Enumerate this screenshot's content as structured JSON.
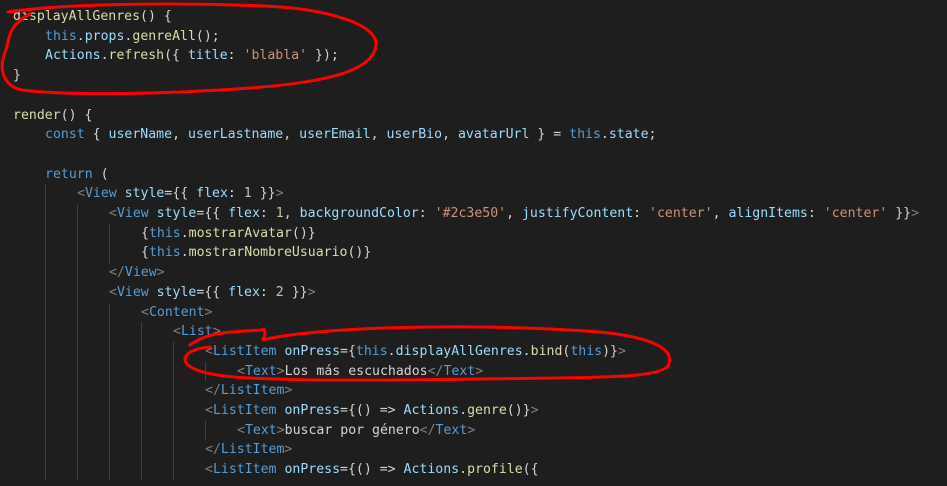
{
  "editor": {
    "colors": {
      "background": "#1e1e1e",
      "keyword": "#569cd6",
      "function": "#dcdcaa",
      "variable": "#9cdcfe",
      "string": "#ce9178",
      "number": "#b5cea8",
      "text": "#d4d4d4",
      "annotation": "#ff0000"
    },
    "lines": [
      {
        "indent": 0,
        "tokens": [
          [
            "fn",
            "displayAllGenres"
          ],
          [
            "plain",
            "() {"
          ]
        ]
      },
      {
        "indent": 1,
        "tokens": [
          [
            "kw",
            "this"
          ],
          [
            "plain",
            "."
          ],
          [
            "var",
            "props"
          ],
          [
            "plain",
            "."
          ],
          [
            "fn",
            "genreAll"
          ],
          [
            "plain",
            "();"
          ]
        ]
      },
      {
        "indent": 1,
        "tokens": [
          [
            "var",
            "Actions"
          ],
          [
            "plain",
            "."
          ],
          [
            "fn",
            "refresh"
          ],
          [
            "plain",
            "({ "
          ],
          [
            "var",
            "title"
          ],
          [
            "plain",
            ": "
          ],
          [
            "str",
            "'blabla'"
          ],
          [
            "plain",
            " });"
          ]
        ]
      },
      {
        "indent": 0,
        "tokens": [
          [
            "plain",
            "}"
          ]
        ]
      },
      {
        "indent": 0,
        "tokens": []
      },
      {
        "indent": 0,
        "tokens": [
          [
            "fn",
            "render"
          ],
          [
            "plain",
            "() {"
          ]
        ]
      },
      {
        "indent": 1,
        "tokens": [
          [
            "kw",
            "const"
          ],
          [
            "plain",
            " { "
          ],
          [
            "var",
            "userName"
          ],
          [
            "plain",
            ", "
          ],
          [
            "var",
            "userLastname"
          ],
          [
            "plain",
            ", "
          ],
          [
            "var",
            "userEmail"
          ],
          [
            "plain",
            ", "
          ],
          [
            "var",
            "userBio"
          ],
          [
            "plain",
            ", "
          ],
          [
            "var",
            "avatarUrl"
          ],
          [
            "plain",
            " } = "
          ],
          [
            "kw",
            "this"
          ],
          [
            "plain",
            "."
          ],
          [
            "var",
            "state"
          ],
          [
            "plain",
            ";"
          ]
        ]
      },
      {
        "indent": 0,
        "tokens": []
      },
      {
        "indent": 1,
        "tokens": [
          [
            "kw",
            "return"
          ],
          [
            "plain",
            " ("
          ]
        ]
      },
      {
        "indent": 2,
        "tokens": [
          [
            "punc",
            "<"
          ],
          [
            "tag",
            "View"
          ],
          [
            "plain",
            " "
          ],
          [
            "attr",
            "style"
          ],
          [
            "plain",
            "={{ "
          ],
          [
            "var",
            "flex"
          ],
          [
            "plain",
            ": "
          ],
          [
            "num",
            "1"
          ],
          [
            "plain",
            " }}"
          ],
          [
            "punc",
            ">"
          ]
        ]
      },
      {
        "indent": 3,
        "tokens": [
          [
            "punc",
            "<"
          ],
          [
            "tag",
            "View"
          ],
          [
            "plain",
            " "
          ],
          [
            "attr",
            "style"
          ],
          [
            "plain",
            "={{ "
          ],
          [
            "var",
            "flex"
          ],
          [
            "plain",
            ": "
          ],
          [
            "num",
            "1"
          ],
          [
            "plain",
            ", "
          ],
          [
            "var",
            "backgroundColor"
          ],
          [
            "plain",
            ": "
          ],
          [
            "str",
            "'#2c3e50'"
          ],
          [
            "plain",
            ", "
          ],
          [
            "var",
            "justifyContent"
          ],
          [
            "plain",
            ": "
          ],
          [
            "str",
            "'center'"
          ],
          [
            "plain",
            ", "
          ],
          [
            "var",
            "alignItems"
          ],
          [
            "plain",
            ": "
          ],
          [
            "str",
            "'center'"
          ],
          [
            "plain",
            " }}"
          ],
          [
            "punc",
            ">"
          ]
        ]
      },
      {
        "indent": 4,
        "tokens": [
          [
            "plain",
            "{"
          ],
          [
            "kw",
            "this"
          ],
          [
            "plain",
            "."
          ],
          [
            "fn",
            "mostrarAvatar"
          ],
          [
            "plain",
            "()}"
          ]
        ]
      },
      {
        "indent": 4,
        "tokens": [
          [
            "plain",
            "{"
          ],
          [
            "kw",
            "this"
          ],
          [
            "plain",
            "."
          ],
          [
            "fn",
            "mostrarNombreUsuario"
          ],
          [
            "plain",
            "()}"
          ]
        ]
      },
      {
        "indent": 3,
        "tokens": [
          [
            "punc",
            "</"
          ],
          [
            "tag",
            "View"
          ],
          [
            "punc",
            ">"
          ]
        ]
      },
      {
        "indent": 3,
        "tokens": [
          [
            "punc",
            "<"
          ],
          [
            "tag",
            "View"
          ],
          [
            "plain",
            " "
          ],
          [
            "attr",
            "style"
          ],
          [
            "plain",
            "={{ "
          ],
          [
            "var",
            "flex"
          ],
          [
            "plain",
            ": "
          ],
          [
            "num",
            "2"
          ],
          [
            "plain",
            " }}"
          ],
          [
            "punc",
            ">"
          ]
        ]
      },
      {
        "indent": 4,
        "tokens": [
          [
            "punc",
            "<"
          ],
          [
            "tag",
            "Content"
          ],
          [
            "punc",
            ">"
          ]
        ]
      },
      {
        "indent": 5,
        "tokens": [
          [
            "punc",
            "<"
          ],
          [
            "tag",
            "List"
          ],
          [
            "punc",
            ">"
          ]
        ]
      },
      {
        "indent": 6,
        "tokens": [
          [
            "punc",
            "<"
          ],
          [
            "tag",
            "ListItem"
          ],
          [
            "plain",
            " "
          ],
          [
            "attr",
            "onPress"
          ],
          [
            "plain",
            "={"
          ],
          [
            "kw",
            "this"
          ],
          [
            "plain",
            "."
          ],
          [
            "var",
            "displayAllGenres"
          ],
          [
            "plain",
            "."
          ],
          [
            "fn",
            "bind"
          ],
          [
            "plain",
            "("
          ],
          [
            "kw",
            "this"
          ],
          [
            "plain",
            ")}"
          ],
          [
            "punc",
            ">"
          ]
        ]
      },
      {
        "indent": 7,
        "tokens": [
          [
            "punc",
            "<"
          ],
          [
            "tag",
            "Text"
          ],
          [
            "punc",
            ">"
          ],
          [
            "txt",
            "Los más escuchados"
          ],
          [
            "punc",
            "</"
          ],
          [
            "tag",
            "Text"
          ],
          [
            "punc",
            ">"
          ]
        ]
      },
      {
        "indent": 6,
        "tokens": [
          [
            "punc",
            "</"
          ],
          [
            "tag",
            "ListItem"
          ],
          [
            "punc",
            ">"
          ]
        ]
      },
      {
        "indent": 6,
        "tokens": [
          [
            "punc",
            "<"
          ],
          [
            "tag",
            "ListItem"
          ],
          [
            "plain",
            " "
          ],
          [
            "attr",
            "onPress"
          ],
          [
            "plain",
            "={() => "
          ],
          [
            "var",
            "Actions"
          ],
          [
            "plain",
            "."
          ],
          [
            "fn",
            "genre"
          ],
          [
            "plain",
            "()}"
          ],
          [
            "punc",
            ">"
          ]
        ]
      },
      {
        "indent": 7,
        "tokens": [
          [
            "punc",
            "<"
          ],
          [
            "tag",
            "Text"
          ],
          [
            "punc",
            ">"
          ],
          [
            "txt",
            "buscar por género"
          ],
          [
            "punc",
            "</"
          ],
          [
            "tag",
            "Text"
          ],
          [
            "punc",
            ">"
          ]
        ]
      },
      {
        "indent": 6,
        "tokens": [
          [
            "punc",
            "</"
          ],
          [
            "tag",
            "ListItem"
          ],
          [
            "punc",
            ">"
          ]
        ]
      },
      {
        "indent": 6,
        "tokens": [
          [
            "punc",
            "<"
          ],
          [
            "tag",
            "ListItem"
          ],
          [
            "plain",
            " "
          ],
          [
            "attr",
            "onPress"
          ],
          [
            "plain",
            "={() => "
          ],
          [
            "var",
            "Actions"
          ],
          [
            "plain",
            "."
          ],
          [
            "fn",
            "profile"
          ],
          [
            "plain",
            "({"
          ]
        ]
      }
    ]
  }
}
